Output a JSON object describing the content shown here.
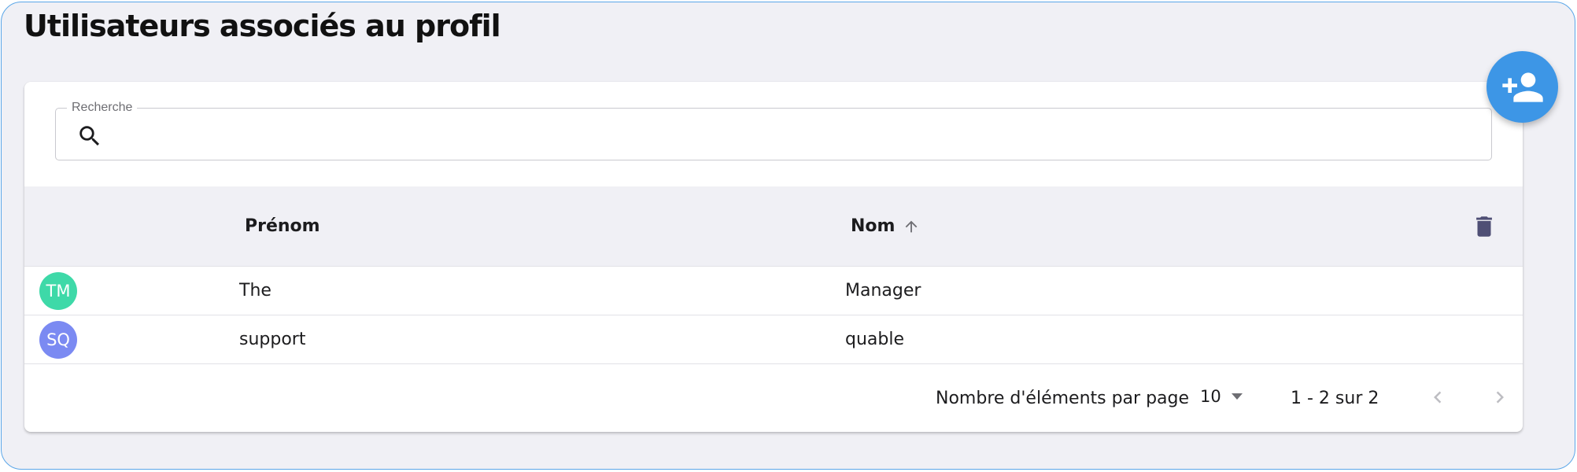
{
  "page": {
    "title": "Utilisateurs associés au profil"
  },
  "search": {
    "label": "Recherche",
    "value": "",
    "placeholder": ""
  },
  "table": {
    "columns": [
      {
        "label": "Prénom"
      },
      {
        "label": "Nom",
        "sort": "ascending"
      }
    ],
    "rows": [
      {
        "initials": "TM",
        "avatar_color": "#3ed9a8",
        "first_name": "The",
        "last_name": "Manager"
      },
      {
        "initials": "SQ",
        "avatar_color": "#7b8af2",
        "first_name": "support",
        "last_name": "quable"
      }
    ]
  },
  "pagination": {
    "items_per_page_label": "Nombre d'éléments par page",
    "page_size": "10",
    "range": "1 - 2 sur 2"
  },
  "colors": {
    "accent": "#3d96e6",
    "background": "#f0f0f5",
    "trash_icon": "#4f4f75"
  },
  "icons": {
    "fab": "add-user-icon",
    "search": "search-icon",
    "sort": "arrow-up-icon",
    "delete": "trash-icon",
    "dropdown": "triangle-down-icon",
    "prev": "chevron-left-icon",
    "next": "chevron-right-icon"
  }
}
